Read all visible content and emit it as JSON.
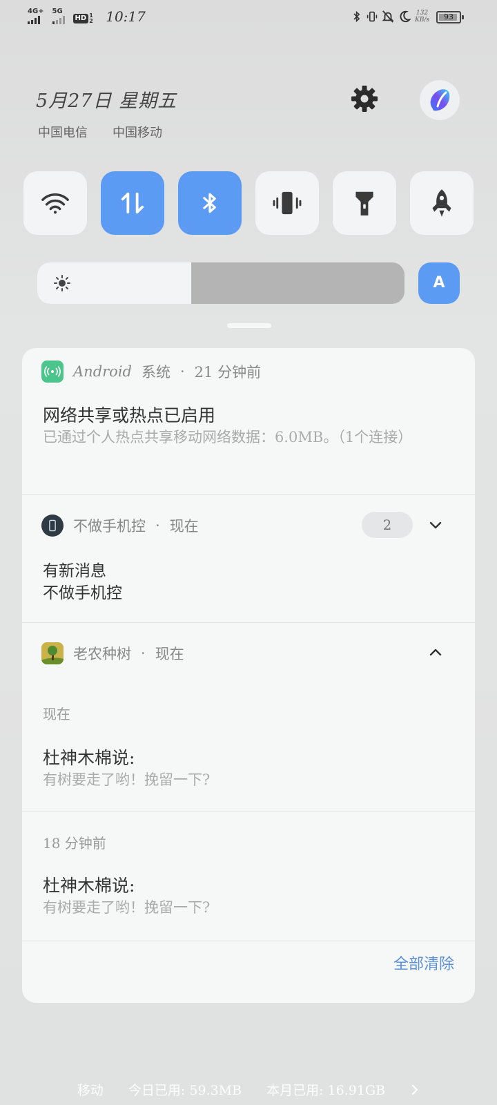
{
  "status_bar": {
    "net1": "4G+",
    "net2": "5G",
    "hd_label": "HD",
    "hd_sub": "1 2",
    "time": "10:17",
    "speed_value": "132",
    "speed_unit": "KB/s",
    "battery": "93"
  },
  "header": {
    "date": "5月27日 星期五",
    "carriers": [
      "中国电信",
      "中国移动"
    ]
  },
  "quick_settings": {
    "tiles": [
      {
        "name": "wifi",
        "active": false
      },
      {
        "name": "mobile-data",
        "active": true
      },
      {
        "name": "bluetooth",
        "active": true
      },
      {
        "name": "vibrate",
        "active": false
      },
      {
        "name": "flashlight",
        "active": false
      },
      {
        "name": "game-mode",
        "active": false
      }
    ],
    "brightness_level": 0.42,
    "auto_brightness_label": "A"
  },
  "notifications": {
    "android": {
      "app": "Android",
      "app_suffix": "系统",
      "time": "21 分钟前",
      "title": "网络共享或热点已启用",
      "body": "已通过个人热点共享移动网络数据：6.0MB。（1个连接）"
    },
    "app2": {
      "app": "不做手机控",
      "time": "现在",
      "count": "2",
      "title": "有新消息",
      "subtitle": "不做手机控"
    },
    "app3": {
      "app": "老农种树",
      "time": "现在",
      "items": [
        {
          "time": "现在",
          "title": "杜神木棉说:",
          "body": "有树要走了哟！挽留一下?"
        },
        {
          "time": "18 分钟前",
          "title": "杜神木棉说:",
          "body": "有树要走了哟！挽留一下?"
        }
      ]
    },
    "clear_all_label": "全部清除"
  },
  "footer": {
    "carrier": "移动",
    "today": "今日已用: 59.3MB",
    "month": "本月已用: 16.91GB"
  },
  "colors": {
    "accent": "#5b9bf3",
    "tile_off": "#f3f4f5",
    "clear_link": "#5b8fd6"
  }
}
